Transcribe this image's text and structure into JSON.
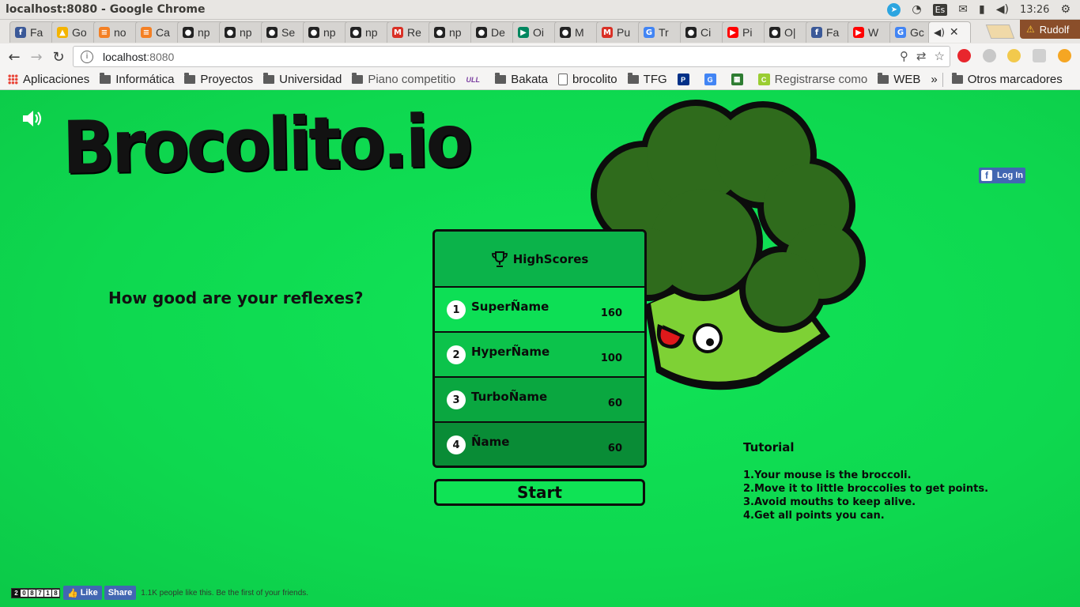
{
  "os": {
    "window_title": "localhost:8080 - Google Chrome",
    "keyboard": "Es",
    "time": "13:26"
  },
  "tabs": [
    {
      "label": "Fa",
      "icon": "facebook-icon",
      "color": "#3b5998",
      "glyph": "f"
    },
    {
      "label": "Go",
      "icon": "drive-icon",
      "color": "#f4b400",
      "glyph": "▲"
    },
    {
      "label": "no",
      "icon": "stackoverflow-icon",
      "color": "#f48024",
      "glyph": "≡"
    },
    {
      "label": "Ca",
      "icon": "stackoverflow-icon",
      "color": "#f48024",
      "glyph": "≡"
    },
    {
      "label": "np",
      "icon": "github-icon",
      "color": "#222222",
      "glyph": "●"
    },
    {
      "label": "np",
      "icon": "github-icon",
      "color": "#222222",
      "glyph": "●"
    },
    {
      "label": "Se",
      "icon": "github-icon",
      "color": "#222222",
      "glyph": "●"
    },
    {
      "label": "np",
      "icon": "github-icon",
      "color": "#222222",
      "glyph": "●"
    },
    {
      "label": "np",
      "icon": "github-icon",
      "color": "#222222",
      "glyph": "●"
    },
    {
      "label": "Re",
      "icon": "gmail-icon",
      "color": "#d93025",
      "glyph": "M"
    },
    {
      "label": "np",
      "icon": "github-icon",
      "color": "#222222",
      "glyph": "●"
    },
    {
      "label": "De",
      "icon": "github-icon",
      "color": "#222222",
      "glyph": "●"
    },
    {
      "label": "Oi",
      "icon": "play-store-icon",
      "color": "#01875f",
      "glyph": "▶"
    },
    {
      "label": "M",
      "icon": "github-icon",
      "color": "#222222",
      "glyph": "●"
    },
    {
      "label": "Pu",
      "icon": "gmail-icon",
      "color": "#d93025",
      "glyph": "M"
    },
    {
      "label": "Tr",
      "icon": "translate-icon",
      "color": "#4285f4",
      "glyph": "G"
    },
    {
      "label": "Ci",
      "icon": "github-icon",
      "color": "#222222",
      "glyph": "●"
    },
    {
      "label": "Pi",
      "icon": "youtube-icon",
      "color": "#ff0000",
      "glyph": "▶"
    },
    {
      "label": "O|",
      "icon": "github-icon",
      "color": "#222222",
      "glyph": "●"
    },
    {
      "label": "Fa",
      "icon": "facebook-icon",
      "color": "#3b5998",
      "glyph": "f"
    },
    {
      "label": "W",
      "icon": "youtube-icon",
      "color": "#ff0000",
      "glyph": "▶"
    },
    {
      "label": "Gc",
      "icon": "google-icon",
      "color": "#4285f4",
      "glyph": "G"
    }
  ],
  "profile": {
    "name": "Rudolf"
  },
  "toolbar": {
    "url_host": "localhost",
    "url_port": ":8080"
  },
  "bookmarks": [
    {
      "label": "Aplicaciones",
      "type": "apps"
    },
    {
      "label": "Informática",
      "type": "folder"
    },
    {
      "label": "Proyectos",
      "type": "folder"
    },
    {
      "label": "Universidad",
      "type": "folder"
    },
    {
      "label": "Piano competitio",
      "type": "folder"
    },
    {
      "label": "",
      "type": "ull",
      "glyph": "ULL"
    },
    {
      "label": "Bakata",
      "type": "folder"
    },
    {
      "label": "brocolito",
      "type": "page"
    },
    {
      "label": "TFG",
      "type": "folder"
    },
    {
      "label": "",
      "type": "icon",
      "glyph": "P",
      "color": "#003087"
    },
    {
      "label": "",
      "type": "icon",
      "glyph": "G",
      "color": "#4285f4"
    },
    {
      "label": "",
      "type": "icon",
      "glyph": "▦",
      "color": "#2e7d32"
    },
    {
      "label": "Registrarse como",
      "type": "icon",
      "glyph": "C",
      "color": "#9acd32"
    },
    {
      "label": "WEB",
      "type": "folder"
    }
  ],
  "bookmarks_more": "»",
  "bookmarks_other": "Otros marcadores",
  "game": {
    "logo": "Brocolito.io",
    "tagline": "How good are your reflexes?",
    "fb_login": "Log In",
    "highscores_title": "HighScores",
    "highscores": [
      {
        "rank": "1",
        "name": "SuperÑame",
        "score": "160",
        "bg": "#0ddf55"
      },
      {
        "rank": "2",
        "name": "HyperÑame",
        "score": "100",
        "bg": "#0cc34b"
      },
      {
        "rank": "3",
        "name": "TurboÑame",
        "score": "60",
        "bg": "#0aa740"
      },
      {
        "rank": "4",
        "name": "Ñame",
        "score": "60",
        "bg": "#098c36"
      }
    ],
    "start_label": "Start",
    "tutorial_title": "Tutorial",
    "tutorial_steps": [
      "1.Your mouse is the broccoli.",
      "2.Move it to little broccolies to get points.",
      "3.Avoid mouths to keep alive.",
      "4.Get all points you can."
    ]
  },
  "social": {
    "counter_digits": [
      "2",
      "0",
      "8",
      "7",
      "1",
      "8"
    ],
    "like_label": "Like",
    "share_label": "Share",
    "likes_text": "1.1K people like this. Be the first of your friends."
  },
  "colors": {
    "game_bg": "#0fdc52",
    "broccoli_head": "#2f6b1c",
    "broccoli_stem": "#7ed135",
    "outline": "#0c0c0c",
    "facebook": "#4267b2"
  }
}
